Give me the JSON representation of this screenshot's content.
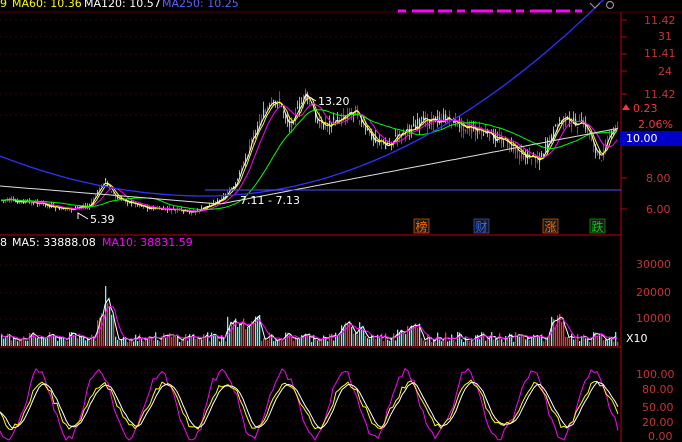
{
  "top_legend": {
    "ma60": "MA60: 10.36",
    "ma120": "MA120: 10.57",
    "ma250": "MA250: 10.25",
    "lead": "9"
  },
  "price_axis": {
    "labels": [
      "11.42",
      "31",
      "11.41",
      "24",
      "11.42",
      "8.00",
      "6.00"
    ],
    "change_pct": "2.06%",
    "change_abs": "0.23",
    "current": "10.00"
  },
  "annotations": {
    "high": "13.20",
    "low": "5.39",
    "range": "7.11 - 7.13"
  },
  "event_tags": [
    {
      "label": "榜",
      "color": "#ff6a00"
    },
    {
      "label": "财",
      "color": "#2f6bff"
    },
    {
      "label": "涨",
      "color": "#ff6a00"
    },
    {
      "label": "跌",
      "color": "#00d000"
    }
  ],
  "volume_legend": {
    "lead": "8",
    "ma5": "MA5: 33888.08",
    "ma10": "MA10: 38831.59"
  },
  "volume_axis": {
    "labels": [
      "30000",
      "20000",
      "10000"
    ],
    "unit": "X10"
  },
  "osc_axis": {
    "labels": [
      "100.00",
      "80.00",
      "50.00",
      "20.00",
      "0.00"
    ]
  },
  "colors": {
    "up": "#ff3232",
    "down": "#54ffff",
    "ma5": "#ffffff",
    "ma10": "#ffff00",
    "ma20": "#ff00ff",
    "ma60": "#00ff00",
    "ma250": "#3030ff",
    "axis": "#c00000"
  }
}
